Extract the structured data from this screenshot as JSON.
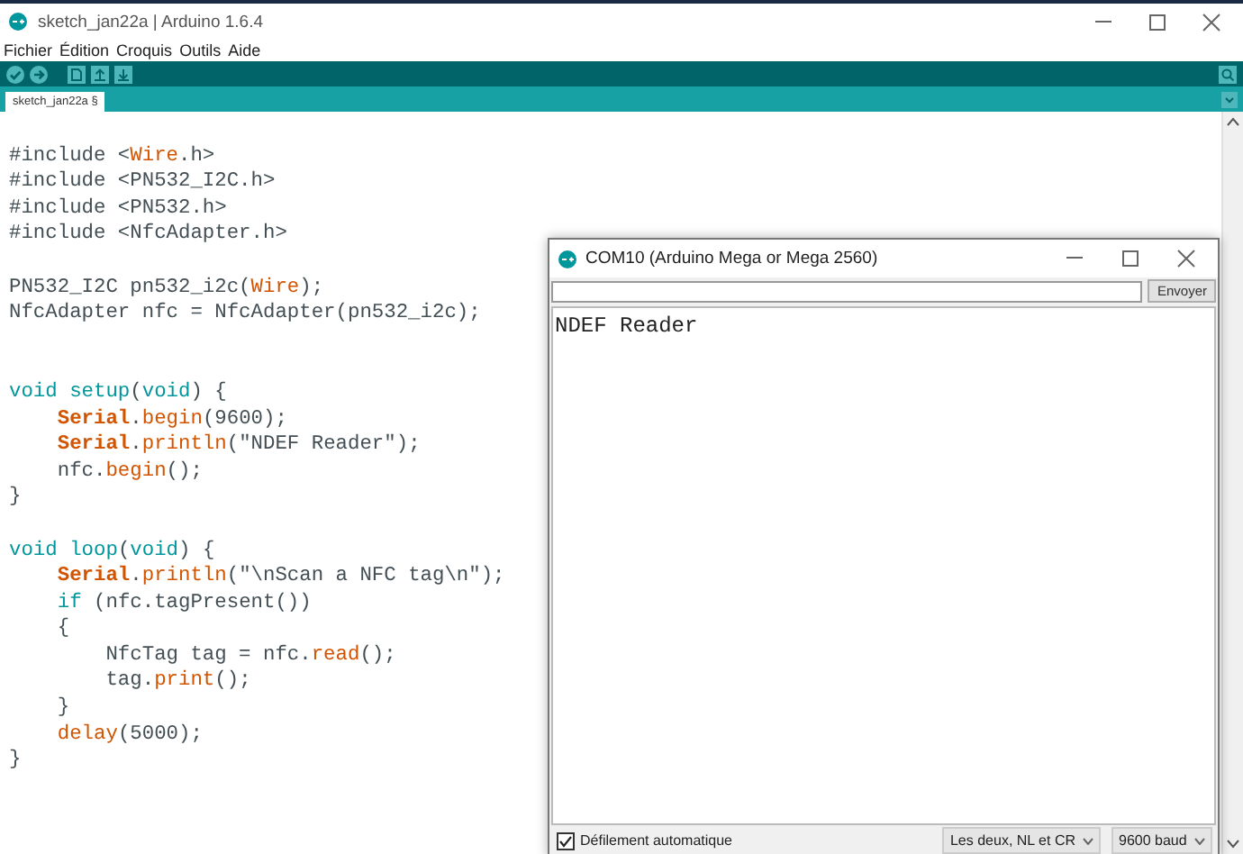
{
  "window": {
    "title": "sketch_jan22a | Arduino 1.6.4",
    "menu": [
      "Fichier",
      "Édition",
      "Croquis",
      "Outils",
      "Aide"
    ],
    "tabs": [
      {
        "label": "sketch_jan22a §",
        "selected": true
      }
    ]
  },
  "editor": {
    "lines": [
      {
        "kind": "blank"
      },
      {
        "kind": "code",
        "tokens": [
          {
            "kind": "plain",
            "text": "#include <"
          },
          {
            "kind": "function",
            "text": "Wire"
          },
          {
            "kind": "plain",
            "text": ".h>"
          }
        ]
      },
      {
        "kind": "code",
        "tokens": [
          {
            "kind": "plain",
            "text": "#include <PN532_I2C.h>"
          }
        ]
      },
      {
        "kind": "code",
        "tokens": [
          {
            "kind": "plain",
            "text": "#include <PN532.h>"
          }
        ]
      },
      {
        "kind": "code",
        "tokens": [
          {
            "kind": "plain",
            "text": "#include <NfcAdapter.h>"
          }
        ]
      },
      {
        "kind": "blank"
      },
      {
        "kind": "code",
        "tokens": [
          {
            "kind": "plain",
            "text": "PN532_I2C pn532_i2c("
          },
          {
            "kind": "function",
            "text": "Wire"
          },
          {
            "kind": "plain",
            "text": ");"
          }
        ]
      },
      {
        "kind": "code",
        "tokens": [
          {
            "kind": "plain",
            "text": "NfcAdapter nfc = NfcAdapter(pn532_i2c);"
          }
        ]
      },
      {
        "kind": "blank"
      },
      {
        "kind": "blank"
      },
      {
        "kind": "code",
        "tokens": [
          {
            "kind": "keyword",
            "text": "void setup"
          },
          {
            "kind": "plain",
            "text": "("
          },
          {
            "kind": "keyword",
            "text": "void"
          },
          {
            "kind": "plain",
            "text": ") {"
          }
        ]
      },
      {
        "kind": "code",
        "tokens": [
          {
            "kind": "class",
            "text": "    Serial"
          },
          {
            "kind": "plain",
            "text": "."
          },
          {
            "kind": "function",
            "text": "begin"
          },
          {
            "kind": "plain",
            "text": "(9600);"
          }
        ]
      },
      {
        "kind": "code",
        "tokens": [
          {
            "kind": "class",
            "text": "    Serial"
          },
          {
            "kind": "plain",
            "text": "."
          },
          {
            "kind": "function",
            "text": "println"
          },
          {
            "kind": "plain",
            "text": "(\"NDEF Reader\");"
          }
        ]
      },
      {
        "kind": "code",
        "tokens": [
          {
            "kind": "plain",
            "text": "    nfc."
          },
          {
            "kind": "function",
            "text": "begin"
          },
          {
            "kind": "plain",
            "text": "();"
          }
        ]
      },
      {
        "kind": "code",
        "tokens": [
          {
            "kind": "plain",
            "text": "}"
          }
        ]
      },
      {
        "kind": "blank"
      },
      {
        "kind": "code",
        "tokens": [
          {
            "kind": "keyword",
            "text": "void loop"
          },
          {
            "kind": "plain",
            "text": "("
          },
          {
            "kind": "keyword",
            "text": "void"
          },
          {
            "kind": "plain",
            "text": ") {"
          }
        ]
      },
      {
        "kind": "code",
        "tokens": [
          {
            "kind": "class",
            "text": "    Serial"
          },
          {
            "kind": "plain",
            "text": "."
          },
          {
            "kind": "function",
            "text": "println"
          },
          {
            "kind": "plain",
            "text": "(\"\\nScan a NFC tag\\n\");"
          }
        ]
      },
      {
        "kind": "code",
        "tokens": [
          {
            "kind": "keyword",
            "text": "    if"
          },
          {
            "kind": "plain",
            "text": " (nfc.tagPresent())"
          }
        ]
      },
      {
        "kind": "code",
        "tokens": [
          {
            "kind": "plain",
            "text": "    {"
          }
        ]
      },
      {
        "kind": "code",
        "tokens": [
          {
            "kind": "plain",
            "text": "        NfcTag tag = nfc."
          },
          {
            "kind": "function",
            "text": "read"
          },
          {
            "kind": "plain",
            "text": "();"
          }
        ]
      },
      {
        "kind": "code",
        "tokens": [
          {
            "kind": "plain",
            "text": "        tag."
          },
          {
            "kind": "function",
            "text": "print"
          },
          {
            "kind": "plain",
            "text": "();"
          }
        ]
      },
      {
        "kind": "code",
        "tokens": [
          {
            "kind": "plain",
            "text": "    }"
          }
        ]
      },
      {
        "kind": "code",
        "tokens": [
          {
            "kind": "function",
            "text": "    delay"
          },
          {
            "kind": "plain",
            "text": "(5000);"
          }
        ]
      },
      {
        "kind": "code",
        "tokens": [
          {
            "kind": "plain",
            "text": "}"
          }
        ]
      }
    ]
  },
  "serial_monitor": {
    "title": "COM10 (Arduino Mega or Mega 2560)",
    "send_button": "Envoyer",
    "output": [
      "NDEF Reader"
    ],
    "autoscroll": {
      "label": "Défilement automatique",
      "checked": true
    },
    "line_ending": "Les deux, NL et CR",
    "baud_rate": "9600 baud"
  }
}
